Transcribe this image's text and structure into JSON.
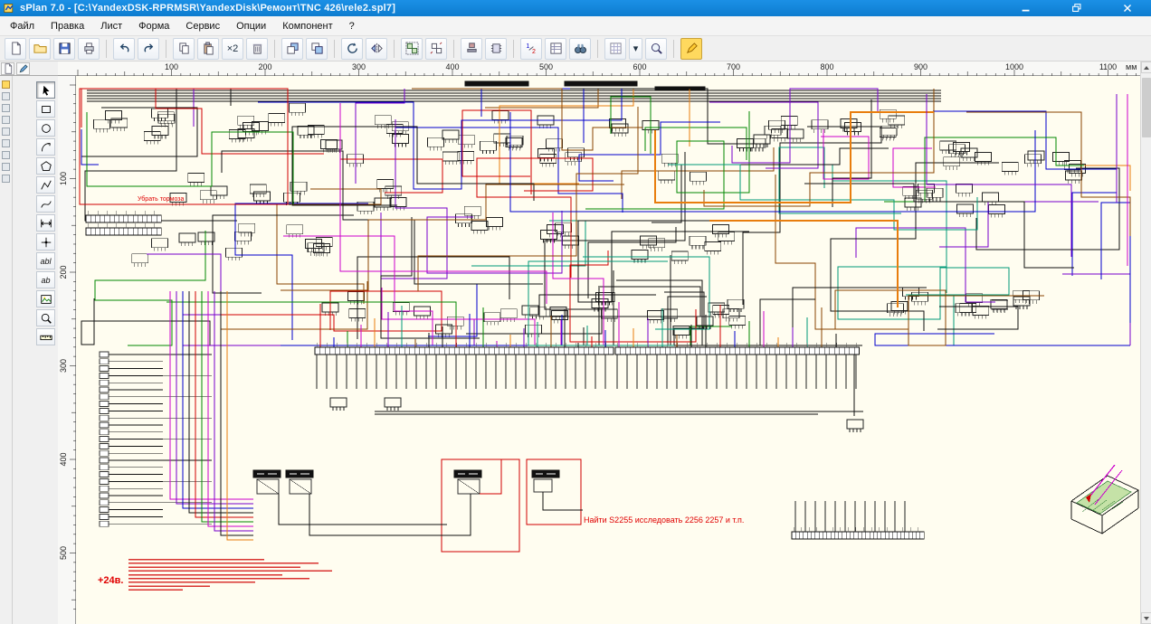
{
  "window": {
    "title": "sPlan 7.0 - [C:\\YandexDSK-RPRMSR\\YandexDisk\\Ремонт\\TNC 426\\rele2.spl7]"
  },
  "menu": {
    "items": [
      "Файл",
      "Правка",
      "Лист",
      "Форма",
      "Сервис",
      "Опции",
      "Компонент",
      "?"
    ]
  },
  "toolbar": {
    "items": [
      {
        "name": "new",
        "icon": "page"
      },
      {
        "name": "open",
        "icon": "folder"
      },
      {
        "name": "save",
        "icon": "floppy"
      },
      {
        "name": "print",
        "icon": "printer"
      },
      {
        "type": "sep"
      },
      {
        "name": "undo",
        "icon": "undo"
      },
      {
        "name": "redo",
        "icon": "redo"
      },
      {
        "type": "sep"
      },
      {
        "name": "copy",
        "icon": "copy"
      },
      {
        "name": "paste",
        "icon": "paste"
      },
      {
        "name": "duplicate",
        "label": "×2"
      },
      {
        "name": "delete",
        "icon": "trash"
      },
      {
        "type": "sep"
      },
      {
        "name": "bring-to-front",
        "icon": "front"
      },
      {
        "name": "send-to-back",
        "icon": "back"
      },
      {
        "type": "sep"
      },
      {
        "name": "rotate",
        "icon": "rotate"
      },
      {
        "name": "mirror",
        "icon": "mirror"
      },
      {
        "type": "sep"
      },
      {
        "name": "group",
        "icon": "group"
      },
      {
        "name": "ungroup",
        "icon": "ungroup"
      },
      {
        "type": "sep"
      },
      {
        "name": "stamp",
        "icon": "stamp"
      },
      {
        "name": "component",
        "icon": "chip"
      },
      {
        "type": "sep"
      },
      {
        "name": "renumber",
        "icon": "renumber"
      },
      {
        "name": "parts-list",
        "icon": "list"
      },
      {
        "name": "find",
        "icon": "binoculars"
      },
      {
        "type": "sep"
      },
      {
        "name": "grid",
        "icon": "grid"
      },
      {
        "name": "grid-dropdown",
        "label": "▾",
        "narrow": true
      },
      {
        "name": "zoom-window",
        "icon": "zoomwin"
      },
      {
        "type": "sep"
      },
      {
        "name": "highlighter",
        "icon": "marker",
        "active": true
      }
    ]
  },
  "palette": {
    "items": [
      {
        "name": "select",
        "icon": "pointer",
        "active": true
      },
      {
        "name": "rectangle",
        "icon": "recttool"
      },
      {
        "name": "ellipse",
        "icon": "circletool"
      },
      {
        "name": "arc",
        "icon": "arctool"
      },
      {
        "name": "polygon",
        "icon": "polygontool"
      },
      {
        "name": "polyline",
        "icon": "polylinetool"
      },
      {
        "name": "bezier",
        "icon": "beziertool"
      },
      {
        "name": "dimension",
        "icon": "dimtool"
      },
      {
        "name": "node",
        "icon": "nodetool"
      },
      {
        "name": "text",
        "label": "abl"
      },
      {
        "name": "text-block",
        "label": "ab"
      },
      {
        "name": "image",
        "icon": "imagetool"
      },
      {
        "name": "zoom",
        "icon": "zoomtool"
      },
      {
        "name": "measure",
        "icon": "rulertool"
      }
    ]
  },
  "rulers": {
    "horizontal_labels": [
      "100",
      "200",
      "300",
      "400",
      "500",
      "600",
      "700",
      "800",
      "900",
      "1000",
      "1100"
    ],
    "unit": "мм",
    "vertical_labels": [
      "100",
      "200",
      "300",
      "400",
      "500"
    ]
  },
  "canvas": {
    "page_background": "#fffdf0",
    "annotations": {
      "find_note": "Найти S2255 исследовать 2256 2257 и т.п.",
      "power_label": "+24в.",
      "brake_note": "Убрать тормоза"
    },
    "wire_colors": [
      "#d00000",
      "#0000cc",
      "#008800",
      "#cc00cc",
      "#e87d0d",
      "#7700cc",
      "#009977",
      "#884400",
      "#111111",
      "#111111"
    ]
  }
}
